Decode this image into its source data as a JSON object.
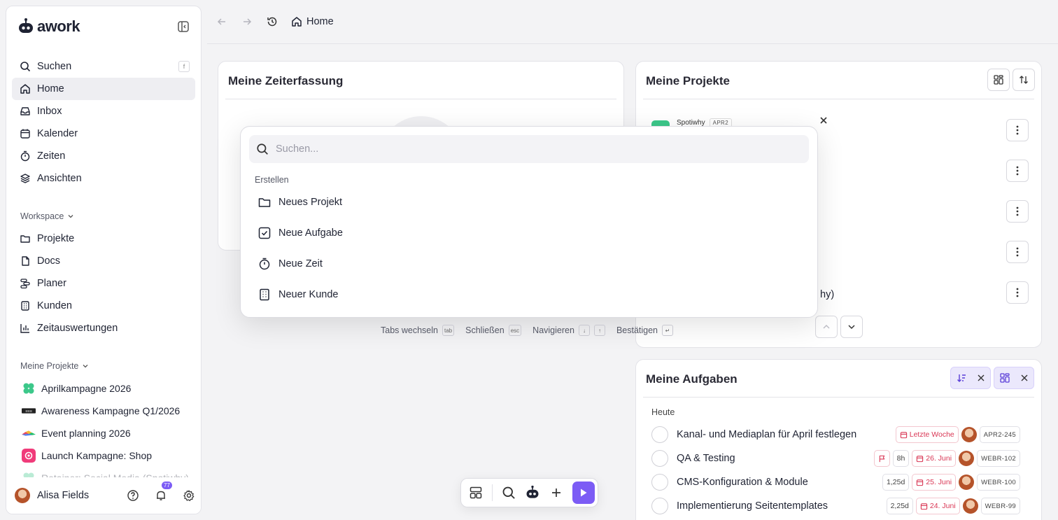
{
  "app": {
    "name": "awork"
  },
  "sidebar": {
    "nav": [
      {
        "label": "Suchen",
        "shortcut": "f"
      },
      {
        "label": "Home"
      },
      {
        "label": "Inbox"
      },
      {
        "label": "Kalender"
      },
      {
        "label": "Zeiten"
      },
      {
        "label": "Ansichten"
      }
    ],
    "workspace_label": "Workspace",
    "workspace": [
      {
        "label": "Projekte"
      },
      {
        "label": "Docs"
      },
      {
        "label": "Planer"
      },
      {
        "label": "Kunden"
      },
      {
        "label": "Zeitauswertungen"
      }
    ],
    "projects_label": "Meine Projekte",
    "projects": [
      {
        "label": "Aprilkampagne 2026"
      },
      {
        "label": "Awareness Kampagne Q1/2026"
      },
      {
        "label": "Event planning 2026"
      },
      {
        "label": "Launch Kampagne: Shop"
      },
      {
        "label": "Retainer: Social Media (Spotiwhy)"
      }
    ],
    "user_name": "Alisa Fields",
    "notification_count": "77"
  },
  "topbar": {
    "breadcrumb": "Home"
  },
  "time_card": {
    "title": "Meine Zeiterfassung"
  },
  "projects_card": {
    "title": "Meine Projekte",
    "first_client": "Spotiwhy",
    "first_key": "APR2",
    "partial_text": "hy)"
  },
  "tasks_card": {
    "title": "Meine Aufgaben",
    "group": "Heute",
    "tasks": [
      {
        "name": "Kanal- und Mediaplan für April festlegen",
        "estimate": "",
        "due": "Letzte Woche",
        "key": "APR2-245"
      },
      {
        "name": "QA & Testing",
        "estimate": "8h",
        "due": "26. Juni",
        "key": "WEBR-102"
      },
      {
        "name": "CMS-Konfiguration & Module",
        "estimate": "1,25d",
        "due": "25. Juni",
        "key": "WEBR-100"
      },
      {
        "name": "Implementierung Seitentemplates",
        "estimate": "2,25d",
        "due": "24. Juni",
        "key": "WEBR-99"
      }
    ]
  },
  "palette": {
    "search_placeholder": "Suchen...",
    "group_label": "Erstellen",
    "items": [
      {
        "label": "Neues Projekt",
        "icon": "folder-icon"
      },
      {
        "label": "Neue Aufgabe",
        "icon": "checkbox-icon"
      },
      {
        "label": "Neue Zeit",
        "icon": "stopwatch-icon"
      },
      {
        "label": "Neuer Kunde",
        "icon": "building-icon"
      }
    ],
    "hints": {
      "switch_tabs": "Tabs wechseln",
      "switch_key": "tab",
      "close": "Schließen",
      "close_key": "esc",
      "navigate": "Navigieren",
      "down_key": "↓",
      "up_key": "↑",
      "confirm": "Bestätigen",
      "confirm_key": "↵"
    }
  },
  "colors": {
    "accent": "#7c5cf5",
    "danger": "#d93654"
  }
}
